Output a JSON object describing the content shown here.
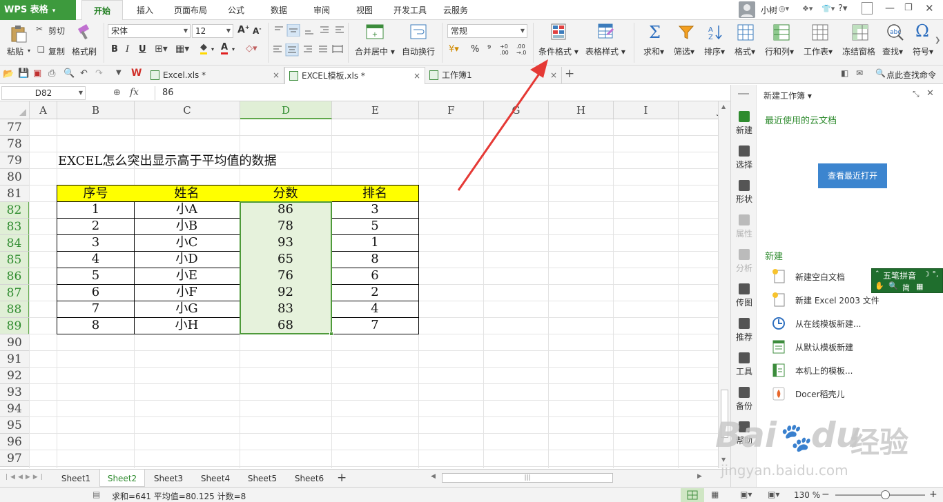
{
  "app": {
    "logo": "WPS 表格",
    "logo_dd": "▾"
  },
  "menu": [
    "开始",
    "插入",
    "页面布局",
    "公式",
    "数据",
    "审阅",
    "视图",
    "开发工具",
    "云服务"
  ],
  "user": {
    "name": "小树",
    "help": "?"
  },
  "ribbon": {
    "paste": "粘贴",
    "cut": "剪切",
    "copy": "复制",
    "format_painter": "格式刷",
    "font_name": "宋体",
    "font_size": "12",
    "bold": "B",
    "italic": "I",
    "underline": "U",
    "merge_center": "合并居中",
    "wrap_text": "自动换行",
    "number_format": "常规",
    "percent": "%",
    "thousands": "⁹",
    "dec_inc": ".00→.0",
    "dec_dec": ".0→.00",
    "conditional_format": "条件格式",
    "table_style": "表格样式",
    "sum": "求和",
    "filter": "筛选",
    "sort": "排序",
    "format": "格式",
    "row_col": "行和列",
    "worksheet": "工作表",
    "freeze": "冻结窗格",
    "find": "查找",
    "symbol": "符号"
  },
  "doc_tabs": [
    {
      "label": "Excel.xls *",
      "close": "×"
    },
    {
      "label": "EXCEL模板.xls *",
      "close": "×"
    },
    {
      "label": "工作簿1",
      "close": "×"
    }
  ],
  "doc_search": "点此查找命令",
  "formula": {
    "name_box": "D82",
    "fx": "fx",
    "value": "86"
  },
  "grid": {
    "columns": [
      "A",
      "B",
      "C",
      "D",
      "E",
      "F",
      "G",
      "H",
      "I",
      "J"
    ],
    "rows": [
      "77",
      "78",
      "79",
      "80",
      "81",
      "82",
      "83",
      "84",
      "85",
      "86",
      "87",
      "88",
      "89",
      "90",
      "91",
      "92",
      "93",
      "94",
      "95",
      "96",
      "97"
    ],
    "title": "EXCEL怎么突出显示高于平均值的数据",
    "headers": [
      "序号",
      "姓名",
      "分数",
      "排名"
    ],
    "data": [
      [
        "1",
        "小A",
        "86",
        "3"
      ],
      [
        "2",
        "小B",
        "78",
        "5"
      ],
      [
        "3",
        "小C",
        "93",
        "1"
      ],
      [
        "4",
        "小D",
        "65",
        "8"
      ],
      [
        "5",
        "小E",
        "76",
        "6"
      ],
      [
        "6",
        "小F",
        "92",
        "2"
      ],
      [
        "7",
        "小G",
        "83",
        "4"
      ],
      [
        "8",
        "小H",
        "68",
        "7"
      ]
    ]
  },
  "sheets": [
    "Sheet1",
    "Sheet2",
    "Sheet3",
    "Sheet4",
    "Sheet5",
    "Sheet6"
  ],
  "sheet_add": "+",
  "status": {
    "text": "求和=641  平均值=80.125  计数=8",
    "zoom": "130 %",
    "minus": "−",
    "plus": "+"
  },
  "panel_strip": [
    {
      "label": "新建",
      "disabled": false
    },
    {
      "label": "选择",
      "disabled": false
    },
    {
      "label": "形状",
      "disabled": false
    },
    {
      "label": "属性",
      "disabled": true
    },
    {
      "label": "分析",
      "disabled": true
    },
    {
      "label": "传图",
      "disabled": false
    },
    {
      "label": "推荐",
      "disabled": false
    },
    {
      "label": "工具",
      "disabled": false
    },
    {
      "label": "备份",
      "disabled": false
    },
    {
      "label": "帮助",
      "disabled": false
    }
  ],
  "panel": {
    "title": "新建工作簿",
    "recent_heading": "最近使用的云文档",
    "recent_button": "查看最近打开",
    "new_heading": "新建",
    "links": [
      "新建空白文档",
      "新建 Excel 2003 文件",
      "从在线模板新建...",
      "从默认模板新建",
      "本机上的模板...",
      "Docer稻壳儿"
    ]
  },
  "ime": {
    "row1": "五笔拼音",
    "row2": "简"
  },
  "watermark": {
    "main": "Bai",
    "paw": "du",
    "suffix": "经验",
    "url": "jingyan.baidu.com"
  }
}
